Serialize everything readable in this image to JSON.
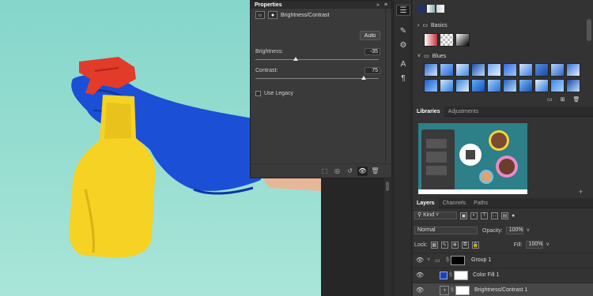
{
  "properties": {
    "tab_title": "Properties",
    "collapse_icon": "double-chevron-right",
    "menu_icon": "hamburger",
    "layer_type": "Brightness/Contrast",
    "auto_label": "Auto",
    "brightness_label": "Brightness:",
    "brightness_value": "-35",
    "brightness_fraction": 0.33,
    "contrast_label": "Contrast:",
    "contrast_value": "75",
    "contrast_fraction": 0.88,
    "legacy_label": "Use Legacy"
  },
  "swatches": {
    "groups": [
      {
        "name": "Basics"
      },
      {
        "name": "Blues"
      }
    ]
  },
  "libraries_tabs": [
    "Libraries",
    "Adjustments"
  ],
  "layers": {
    "tabs": [
      "Layers",
      "Channels",
      "Paths"
    ],
    "filter_kind": "Kind",
    "blend_mode": "Normal",
    "opacity_label": "Opacity:",
    "opacity_value": "100%",
    "lock_label": "Lock:",
    "fill_label": "Fill:",
    "fill_value": "100%",
    "items": [
      {
        "name": "Group 1"
      },
      {
        "name": "Color Fill 1"
      },
      {
        "name": "Brightness/Contrast 1"
      }
    ]
  },
  "colors": {
    "canvas_bg": "#94dccf",
    "glove_blue": "#1b4fd6",
    "bottle_yellow": "#f5d224",
    "nozzle_red": "#e23b2a",
    "color_fill_swatch": "#1740cf"
  }
}
